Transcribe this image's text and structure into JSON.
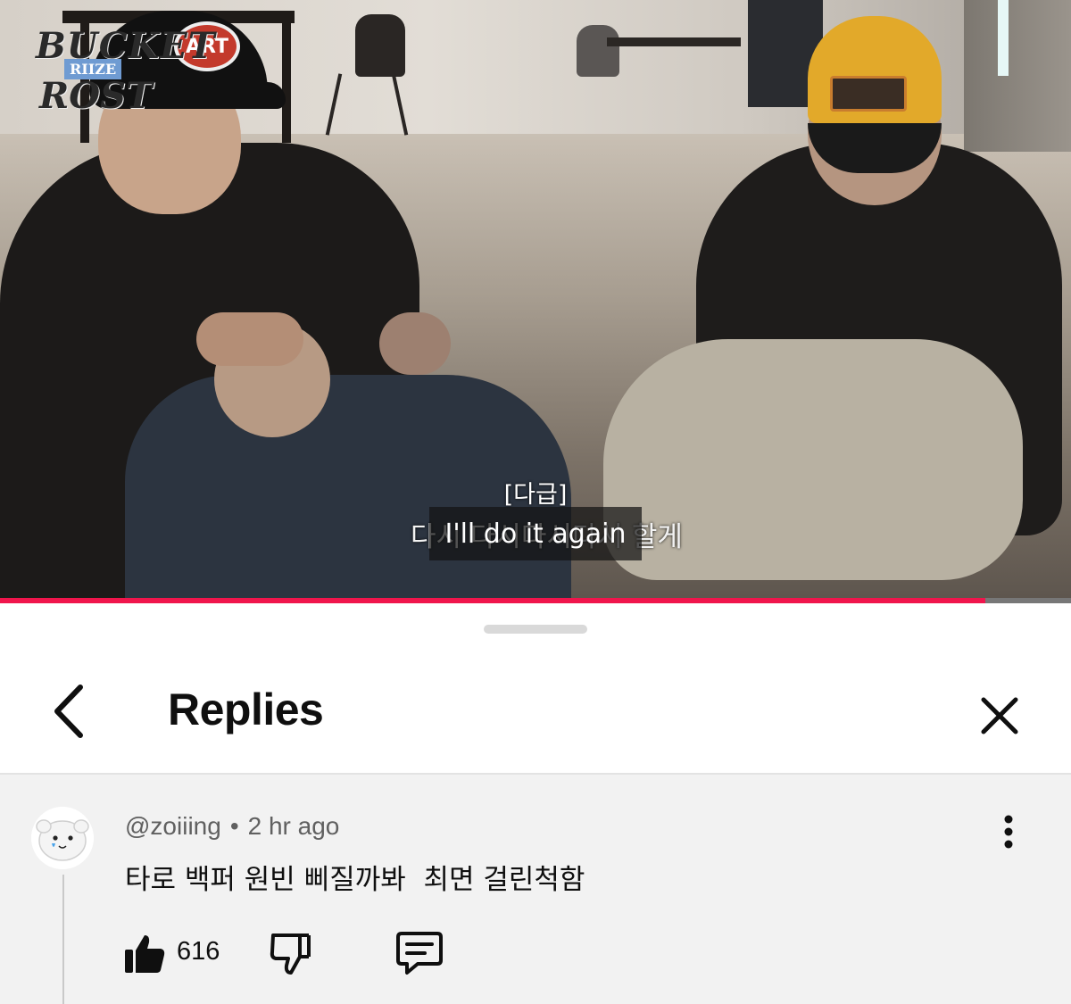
{
  "video": {
    "logo_line1": "BUCKET",
    "logo_tag": "RIIZE",
    "logo_line2": "ROST",
    "cap_badge": "ART",
    "subtitle_small": "[다급]",
    "subtitle_korean": "다시 다시다시다시 할게",
    "subtitle_english": "I'll do it again",
    "progress_fraction": 0.92
  },
  "sheet": {
    "title": "Replies",
    "back_icon": "chevron-left-icon",
    "close_icon": "close-icon"
  },
  "comment": {
    "author": "@zoiiing",
    "separator": "•",
    "time": "2 hr ago",
    "text": "타로 백퍼 원빈 삐질까봐  최면 걸린척함",
    "like_count": "616",
    "icons": {
      "like": "thumbs-up-icon",
      "dislike": "thumbs-down-icon",
      "reply": "reply-bubble-icon",
      "more": "more-vertical-icon"
    }
  },
  "colors": {
    "progress_red": "#f0154c",
    "comment_bg": "#f2f2f2",
    "meta_gray": "#606060"
  }
}
